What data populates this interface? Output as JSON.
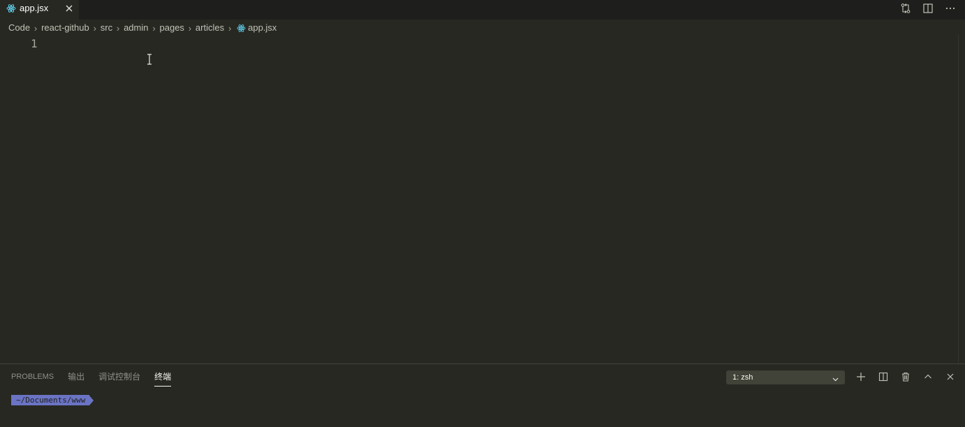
{
  "tab": {
    "label": "app.jsx",
    "icon": "react-icon"
  },
  "toolbar": {
    "icons": [
      "compare-changes-icon",
      "split-editor-icon",
      "more-actions-icon"
    ]
  },
  "breadcrumb": {
    "items": [
      "Code",
      "react-github",
      "src",
      "admin",
      "pages",
      "articles"
    ],
    "file": "app.jsx"
  },
  "editor": {
    "line_numbers": [
      "1"
    ]
  },
  "panel": {
    "tabs": [
      {
        "label": "PROBLEMS",
        "active": false
      },
      {
        "label": "输出",
        "active": false
      },
      {
        "label": "调试控制台",
        "active": false
      },
      {
        "label": "终端",
        "active": true
      }
    ],
    "terminal_select": "1: zsh",
    "actions": [
      "new-terminal-icon",
      "split-terminal-icon",
      "kill-terminal-icon",
      "maximize-panel-icon",
      "close-panel-icon"
    ]
  },
  "terminal": {
    "prompt_path": "~/Documents/www"
  },
  "colors": {
    "background": "#272822",
    "tabbar": "#1e1f1c",
    "prompt_bg": "#6b74c4",
    "react_blue": "#61dafb"
  }
}
